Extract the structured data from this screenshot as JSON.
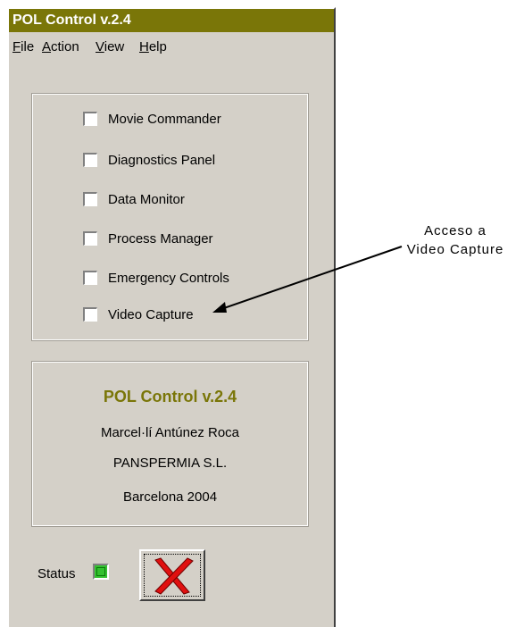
{
  "window": {
    "title": "POL Control v.2.4"
  },
  "menu": [
    {
      "label": "File",
      "u": "F",
      "rest": "ile"
    },
    {
      "label": "Action",
      "u": "A",
      "rest": "ction"
    },
    {
      "label": "View",
      "u": "V",
      "rest": "iew"
    },
    {
      "label": "Help",
      "u": "H",
      "rest": "elp"
    }
  ],
  "modules": [
    {
      "label": "Movie Commander",
      "checked": false
    },
    {
      "label": "Diagnostics Panel",
      "checked": false
    },
    {
      "label": "Data Monitor",
      "checked": false
    },
    {
      "label": "Process Manager",
      "checked": false
    },
    {
      "label": "Emergency Controls",
      "checked": false
    },
    {
      "label": "Video Capture",
      "checked": false
    }
  ],
  "info": {
    "title": "POL Control v.2.4",
    "author": "Marcel·lí Antúnez Roca",
    "company": "PANSPERMIA S.L.",
    "place": "Barcelona 2004"
  },
  "status": {
    "label": "Status",
    "state_color": "#33c02f"
  },
  "annotation": {
    "line1": "Acceso a",
    "line2": "Video Capture"
  },
  "colors": {
    "title_bar": "#7a7608",
    "window_bg": "#d4d0c8",
    "accent_text": "#7a7608"
  },
  "icons": {
    "close": "red-x-icon"
  }
}
